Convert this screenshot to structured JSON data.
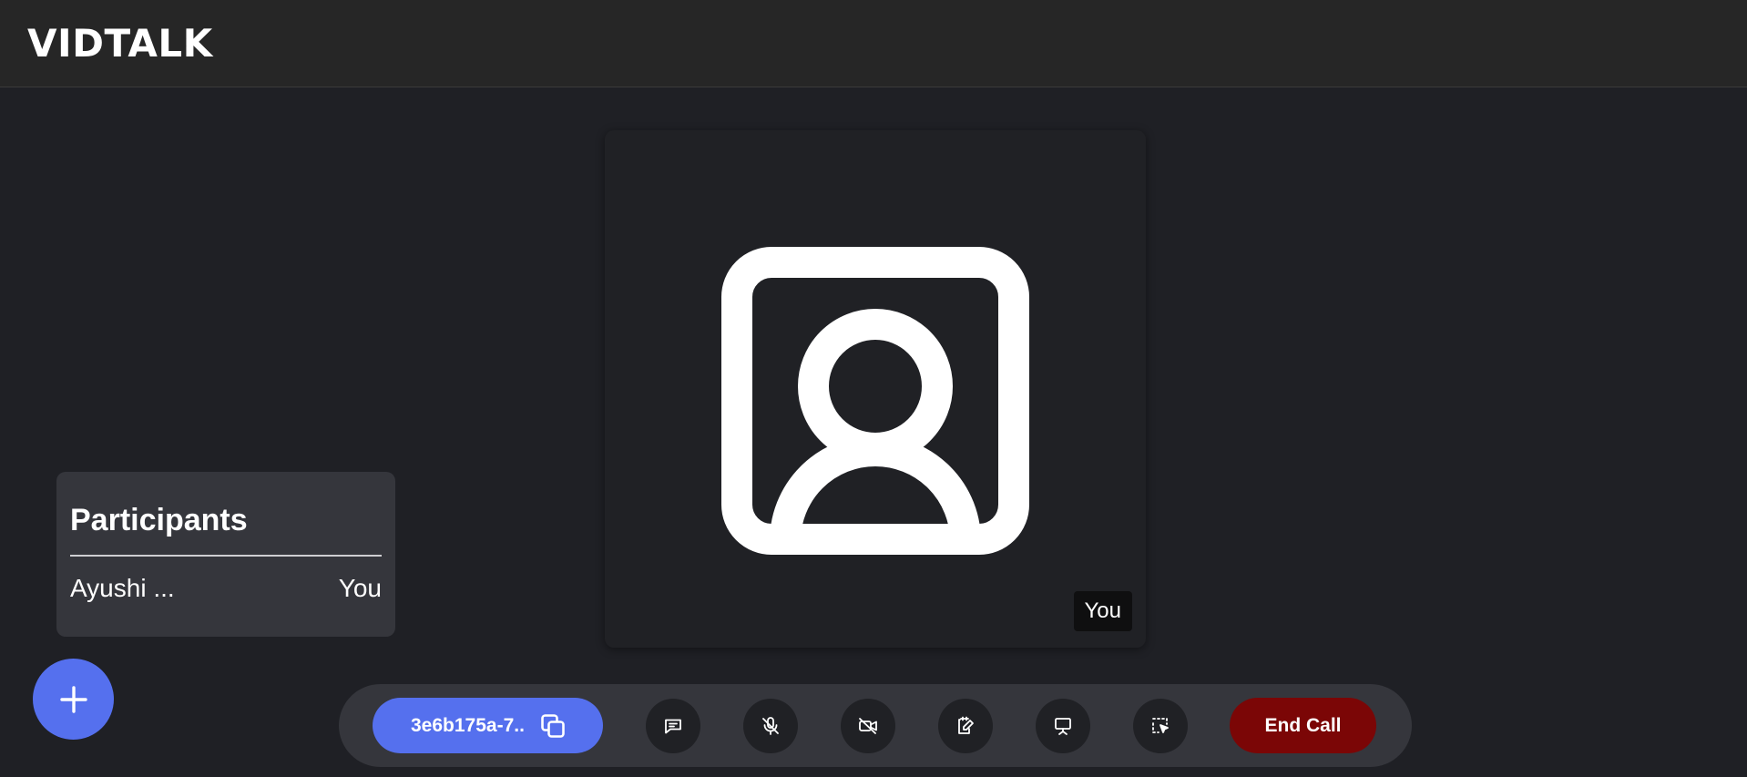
{
  "app": {
    "title": "VIDTALK"
  },
  "video": {
    "name_tag": "You",
    "icon": "user-square-icon"
  },
  "participants": {
    "title": "Participants",
    "list": [
      {
        "name": "Ayushi ...",
        "tag": "You"
      }
    ]
  },
  "fab": {
    "icon": "plus-icon"
  },
  "controls": {
    "meeting_id": "3e6b175a-7..",
    "copy_icon": "copy-icon",
    "buttons": [
      {
        "name": "chat",
        "icon": "chat-icon"
      },
      {
        "name": "mic",
        "icon": "mic-off-icon"
      },
      {
        "name": "camera",
        "icon": "video-off-icon"
      },
      {
        "name": "whiteboard",
        "icon": "notepad-edit-icon"
      },
      {
        "name": "screen-share",
        "icon": "presentation-icon"
      },
      {
        "name": "select",
        "icon": "select-cursor-icon"
      }
    ],
    "end_call_label": "End Call"
  },
  "colors": {
    "background": "#1f2025",
    "topbar": "#262626",
    "accent": "#5570ee",
    "panel": "#35363c",
    "control_button": "#202125",
    "end_call": "#7b0606"
  }
}
